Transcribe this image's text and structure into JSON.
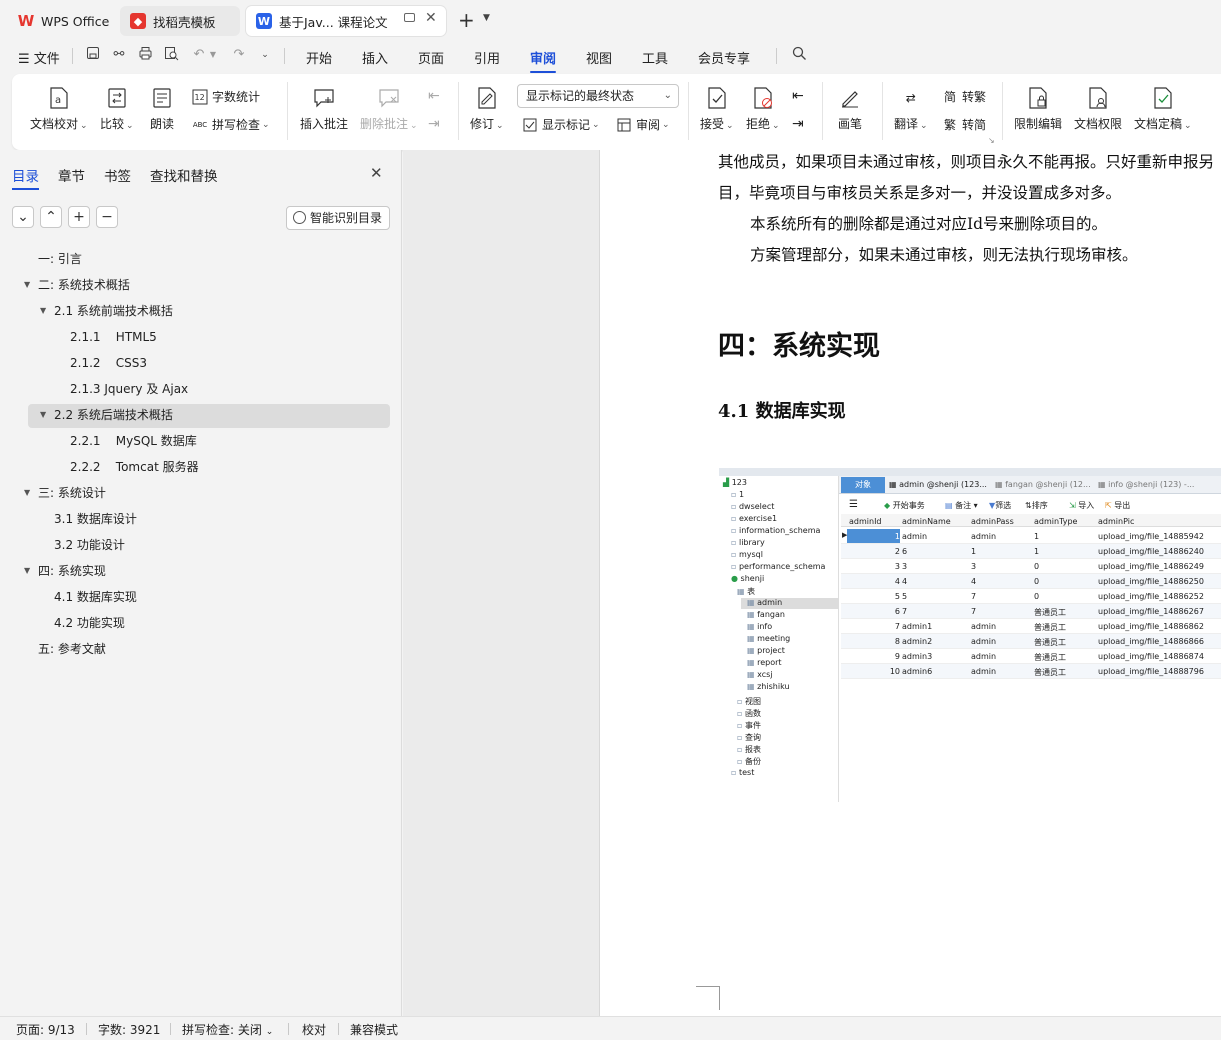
{
  "tabs": [
    {
      "label": "WPS Office"
    },
    {
      "label": "找稻壳模板"
    },
    {
      "label": "基于Jav... 课程论文"
    }
  ],
  "menu": {
    "file": "文件",
    "items": [
      "开始",
      "插入",
      "页面",
      "引用",
      "审阅",
      "视图",
      "工具",
      "会员专享"
    ],
    "active": "审阅"
  },
  "ribbon": {
    "doc_proof": "文档校对",
    "compare": "比较",
    "read_aloud": "朗读",
    "word_count": "字数统计",
    "spell_check": "拼写检查",
    "insert_comment": "插入批注",
    "delete_comment": "删除批注",
    "track_changes": "修订",
    "markup_select": "显示标记的最终状态",
    "show_markup": "显示标记",
    "review": "审阅",
    "accept": "接受",
    "reject": "拒绝",
    "pen": "画笔",
    "translate": "翻译",
    "to_traditional": "转繁",
    "to_simplified": "转简",
    "restrict_edit": "限制编辑",
    "doc_permission": "文档权限",
    "doc_finalize": "文档定稿"
  },
  "panel": {
    "tabs": [
      "目录",
      "章节",
      "书签",
      "查找和替换"
    ],
    "smart_button": "智能识别目录",
    "toc": [
      {
        "label": "一: 引言"
      },
      {
        "label": "二: 系统技术概括"
      },
      {
        "label": "2.1 系统前端技术概括"
      },
      {
        "label": "2.1.1    HTML5"
      },
      {
        "label": "2.1.2    CSS3"
      },
      {
        "label": "2.1.3 Jquery 及 Ajax"
      },
      {
        "label": "2.2 系统后端技术概括"
      },
      {
        "label": "2.2.1    MySQL 数据库"
      },
      {
        "label": "2.2.2    Tomcat 服务器"
      },
      {
        "label": "三: 系统设计"
      },
      {
        "label": "3.1 数据库设计"
      },
      {
        "label": "3.2 功能设计"
      },
      {
        "label": "四: 系统实现"
      },
      {
        "label": "4.1 数据库实现"
      },
      {
        "label": "4.2 功能实现"
      },
      {
        "label": "五: 参考文献"
      }
    ]
  },
  "document": {
    "line1": "其他成员，如果项目未通过审核，则项目永久不能再报。只好重新申报另",
    "line2": "目，毕竟项目与审核员关系是多对一，并没设置成多对多。",
    "line3": "本系统所有的删除都是通过对应Id号来删除项目的。",
    "line4": "方案管理部分，如果未通过审核，则无法执行现场审核。",
    "heading1": "四：系统实现",
    "heading2": "4.1 数据库实现"
  },
  "screenshot": {
    "tabs": [
      "对象",
      "admin @shenji (123...",
      "fangan @shenji (12...",
      "info @shenji (123) -..."
    ],
    "toolbar": [
      "开始事务",
      "备注",
      "筛选",
      "排序",
      "导入",
      "导出"
    ],
    "tree": [
      "123",
      "1",
      "dwselect",
      "exercise1",
      "information_schema",
      "library",
      "mysql",
      "performance_schema",
      "shenji",
      "表",
      "admin",
      "fangan",
      "info",
      "meeting",
      "project",
      "report",
      "xcsj",
      "zhishiku",
      "视图",
      "函数",
      "事件",
      "查询",
      "报表",
      "备份",
      "test"
    ],
    "columns": [
      "adminId",
      "adminName",
      "adminPass",
      "adminType",
      "adminPic"
    ],
    "rows": [
      [
        "1",
        "admin",
        "admin",
        "1",
        "upload_img/file_14885942"
      ],
      [
        "2",
        "6",
        "1",
        "1",
        "upload_img/file_14886240"
      ],
      [
        "3",
        "3",
        "3",
        "0",
        "upload_img/file_14886249"
      ],
      [
        "4",
        "4",
        "4",
        "0",
        "upload_img/file_14886250"
      ],
      [
        "5",
        "5",
        "7",
        "0",
        "upload_img/file_14886252"
      ],
      [
        "6",
        "7",
        "7",
        "普通员工",
        "upload_img/file_14886267"
      ],
      [
        "7",
        "admin1",
        "admin",
        "普通员工",
        "upload_img/file_14886862"
      ],
      [
        "8",
        "admin2",
        "admin",
        "普通员工",
        "upload_img/file_14886866"
      ],
      [
        "9",
        "admin3",
        "admin",
        "普通员工",
        "upload_img/file_14886874"
      ],
      [
        "10",
        "admin6",
        "admin",
        "普通员工",
        "upload_img/file_14888796"
      ]
    ]
  },
  "status": {
    "page": "页面: 9/13",
    "words": "字数: 3921",
    "spell": "拼写检查: 关闭",
    "proof": "校对",
    "compat": "兼容模式"
  },
  "colors": {
    "accent": "#1d4fd8",
    "wps_red": "#e5362f"
  }
}
